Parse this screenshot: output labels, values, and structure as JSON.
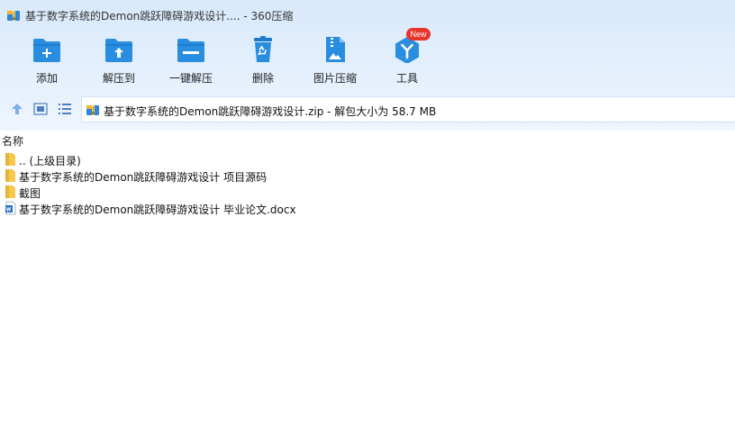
{
  "window": {
    "title": "基于数字系统的Demon跳跃障碍游戏设计.... - 360压缩"
  },
  "toolbar": {
    "items": [
      {
        "label": "添加",
        "icon": "add-folder-icon"
      },
      {
        "label": "解压到",
        "icon": "extract-folder-icon"
      },
      {
        "label": "一键解压",
        "icon": "one-click-extract-icon"
      },
      {
        "label": "删除",
        "icon": "recycle-bin-icon"
      },
      {
        "label": "图片压缩",
        "icon": "image-compress-icon"
      },
      {
        "label": "工具",
        "icon": "tools-icon",
        "badge": "New"
      }
    ]
  },
  "nav": {
    "up_icon": "up-arrow-icon",
    "thumbnail_icon": "thumbnail-view-icon",
    "list_icon": "list-view-icon"
  },
  "address": {
    "text": "基于数字系统的Demon跳跃障碍游戏设计.zip - 解包大小为 58.7 MB"
  },
  "file_list": {
    "column_name": "名称",
    "rows": [
      {
        "name": ".. (上级目录)",
        "type": "folder"
      },
      {
        "name": "基于数字系统的Demon跳跃障碍游戏设计 项目源码",
        "type": "folder"
      },
      {
        "name": "截图",
        "type": "folder"
      },
      {
        "name": "基于数字系统的Demon跳跃障碍游戏设计 毕业论文.docx",
        "type": "docx"
      }
    ]
  },
  "colors": {
    "accent_blue": "#2a8ee0",
    "folder_yellow": "#f5c94e",
    "badge_red": "#e8352b"
  }
}
